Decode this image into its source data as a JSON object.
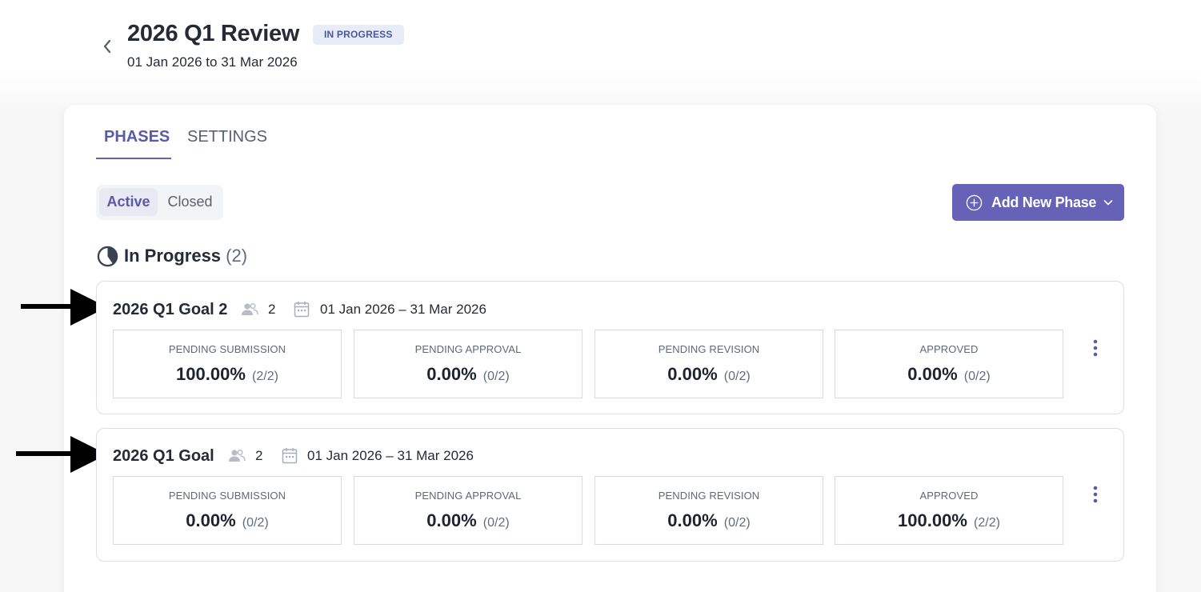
{
  "header": {
    "title": "2026 Q1 Review",
    "status": "IN PROGRESS",
    "date_range": "01 Jan 2026 to 31 Mar 2026"
  },
  "tabs": [
    {
      "label": "PHASES",
      "active": true
    },
    {
      "label": "SETTINGS",
      "active": false
    }
  ],
  "filter": {
    "active_label": "Active",
    "closed_label": "Closed"
  },
  "add_phase_label": "Add New Phase",
  "section": {
    "title": "In Progress",
    "count": "(2)"
  },
  "phases": [
    {
      "name": "2026 Q1 Goal 2",
      "participants": "2",
      "dates": "01 Jan 2026 – 31 Mar 2026",
      "stats": [
        {
          "label": "PENDING SUBMISSION",
          "value": "100.00%",
          "ratio": "(2/2)"
        },
        {
          "label": "PENDING APPROVAL",
          "value": "0.00%",
          "ratio": "(0/2)"
        },
        {
          "label": "PENDING REVISION",
          "value": "0.00%",
          "ratio": "(0/2)"
        },
        {
          "label": "APPROVED",
          "value": "0.00%",
          "ratio": "(0/2)"
        }
      ]
    },
    {
      "name": "2026 Q1 Goal",
      "participants": "2",
      "dates": "01 Jan 2026 – 31 Mar 2026",
      "stats": [
        {
          "label": "PENDING SUBMISSION",
          "value": "0.00%",
          "ratio": "(0/2)"
        },
        {
          "label": "PENDING APPROVAL",
          "value": "0.00%",
          "ratio": "(0/2)"
        },
        {
          "label": "PENDING REVISION",
          "value": "0.00%",
          "ratio": "(0/2)"
        },
        {
          "label": "APPROVED",
          "value": "100.00%",
          "ratio": "(2/2)"
        }
      ]
    }
  ],
  "colors": {
    "accent": "#6662b8",
    "badge_bg": "#e8ecf7",
    "badge_text": "#4a57a0"
  }
}
